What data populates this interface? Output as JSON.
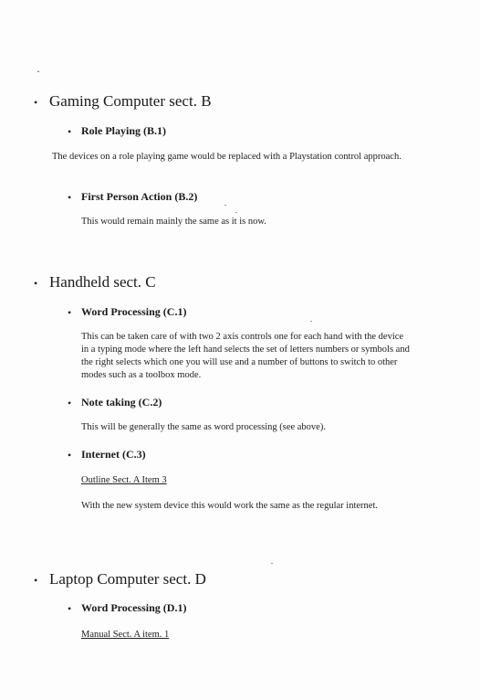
{
  "sections": [
    {
      "heading": "Gaming Computer  sect. B",
      "items": [
        {
          "title": "Role Playing (B.1)",
          "body": "The devices on a role playing game would be replaced with a Playstation control approach."
        },
        {
          "title": "First Person Action (B.2)",
          "body": "This would remain mainly the same as it is now."
        }
      ]
    },
    {
      "heading": "Handheld  sect. C",
      "items": [
        {
          "title": "Word Processing  (C.1)",
          "body": "This can be taken care of with two 2 axis controls one for each hand with the device in a typing mode where the left hand selects the set of letters numbers or symbols and the right selects which one you will use and a number of buttons to switch to other modes such as a toolbox mode."
        },
        {
          "title": "Note taking  (C.2)",
          "body": "This will be generally the same as word processing (see above)."
        },
        {
          "title": "Internet  (C.3)",
          "link": "Outline Sect. A Item 3",
          "body": "With the new system device this would work the same as the regular internet."
        }
      ]
    },
    {
      "heading": "Laptop Computer  sect. D",
      "items": [
        {
          "title": "Word Processing (D.1)",
          "link": "Manual Sect. A item. 1"
        }
      ]
    }
  ]
}
